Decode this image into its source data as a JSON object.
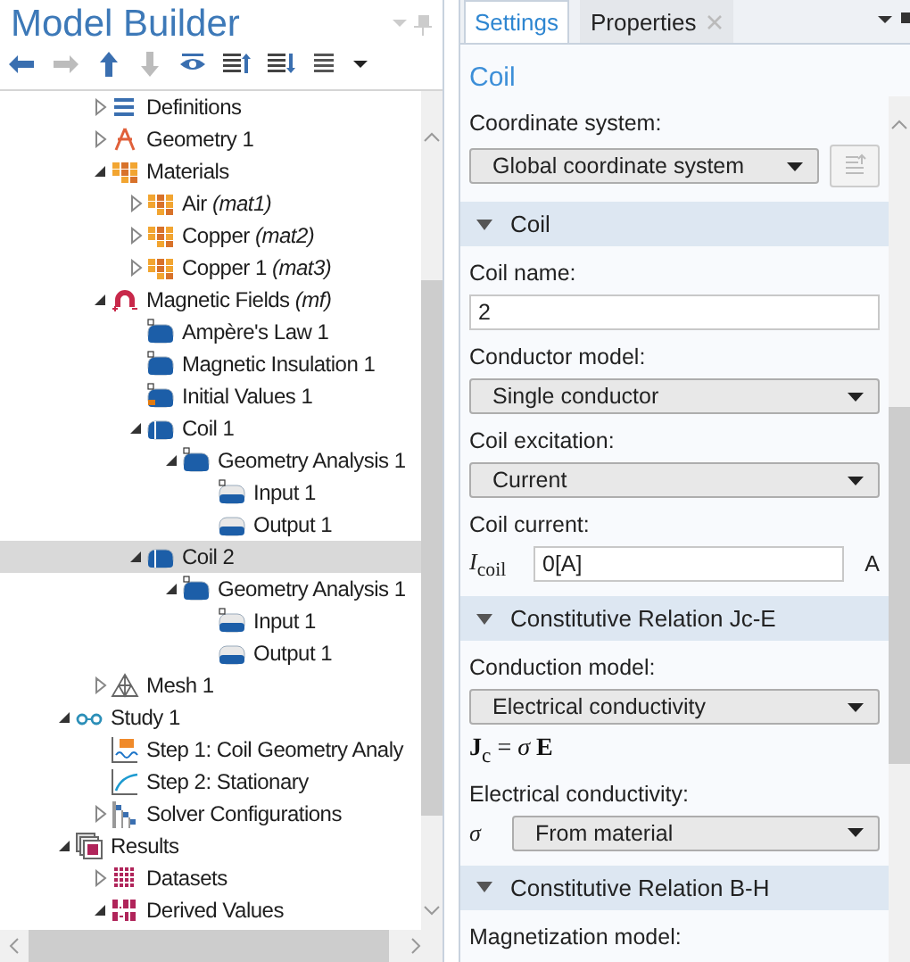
{
  "model_builder": {
    "title": "Model Builder",
    "toolbar": [
      {
        "kind": "back",
        "disabled": false
      },
      {
        "kind": "forward",
        "disabled": true
      },
      {
        "kind": "up",
        "disabled": false
      },
      {
        "kind": "down",
        "disabled": true
      },
      {
        "kind": "eye",
        "disabled": false
      },
      {
        "kind": "sort-up",
        "disabled": false
      },
      {
        "kind": "sort-down",
        "disabled": false
      },
      {
        "kind": "list",
        "disabled": false
      },
      {
        "kind": "caret",
        "disabled": false
      }
    ],
    "component_nodes": [
      {
        "label": "Definitions",
        "kind": "definitions",
        "expanded": false,
        "selected": false
      },
      {
        "label": "Geometry 1",
        "kind": "geometry",
        "expanded": false,
        "selected": false
      },
      {
        "label": "Materials",
        "kind": "material",
        "expanded": true,
        "selected": false,
        "children": [
          {
            "label": "Air *(mat1)*",
            "kind": "material",
            "expanded": false,
            "selected": false
          },
          {
            "label": "Copper *(mat2)*",
            "kind": "material",
            "expanded": false,
            "selected": false
          },
          {
            "label": "Copper 1 *(mat3)*",
            "kind": "material",
            "expanded": false,
            "selected": false
          }
        ]
      },
      {
        "label": "Magnetic Fields *(mf)*",
        "kind": "magnet",
        "expanded": true,
        "selected": false,
        "children": [
          {
            "label": "Ampère's Law 1",
            "kind": "domain",
            "selected": false
          },
          {
            "label": "Magnetic Insulation 1",
            "kind": "domain",
            "selected": false
          },
          {
            "label": "Initial Values 1",
            "kind": "initial",
            "selected": false
          },
          {
            "label": "Coil 1",
            "kind": "coil",
            "expanded": true,
            "selected": false,
            "children": [
              {
                "label": "Geometry Analysis 1",
                "kind": "domain",
                "expanded": true,
                "selected": false,
                "children": [
                  {
                    "label": "Input 1",
                    "kind": "input",
                    "selected": false
                  },
                  {
                    "label": "Output 1",
                    "kind": "output",
                    "selected": false
                  }
                ]
              }
            ]
          },
          {
            "label": "Coil 2",
            "kind": "coil",
            "expanded": true,
            "selected": true,
            "children": [
              {
                "label": "Geometry Analysis 1",
                "kind": "domain",
                "expanded": true,
                "selected": false,
                "children": [
                  {
                    "label": "Input 1",
                    "kind": "input",
                    "selected": false
                  },
                  {
                    "label": "Output 1",
                    "kind": "output",
                    "selected": false
                  }
                ]
              }
            ]
          }
        ]
      },
      {
        "label": "Mesh 1",
        "kind": "mesh",
        "expanded": false,
        "selected": false
      }
    ],
    "tree": [
      {
        "label": "Study 1",
        "kind": "study",
        "expanded": true,
        "selected": false,
        "children": [
          {
            "label": "Step 1: Coil Geometry Analy",
            "kind": "step-analysis",
            "selected": false
          },
          {
            "label": "Step 2: Stationary",
            "kind": "step-stationary",
            "selected": false
          },
          {
            "label": "Solver Configurations",
            "kind": "solver",
            "expanded": false,
            "selected": false
          }
        ]
      },
      {
        "label": "Results",
        "kind": "results",
        "expanded": true,
        "selected": false,
        "children": [
          {
            "label": "Datasets",
            "kind": "datasets",
            "expanded": false,
            "selected": false
          },
          {
            "label": "Derived Values",
            "kind": "derived",
            "expanded": true,
            "selected": false
          }
        ]
      }
    ]
  },
  "tabs": [
    {
      "label": "Settings",
      "selected": true
    },
    {
      "label": "Properties",
      "selected": false
    }
  ],
  "settings": {
    "title": "Coil",
    "groups": [
      {
        "items": [
          {
            "kind": "label",
            "text": "Coordinate system:"
          },
          {
            "kind": "select",
            "value": "Global coordinate system",
            "side_button": true
          }
        ]
      },
      {
        "header": "Coil",
        "expanded": true,
        "items": [
          {
            "kind": "label",
            "text": "Coil name:"
          },
          {
            "kind": "input",
            "value": "2"
          },
          {
            "kind": "label",
            "text": "Conductor model:"
          },
          {
            "kind": "select",
            "value": "Single conductor"
          },
          {
            "kind": "label",
            "text": "Coil excitation:"
          },
          {
            "kind": "select",
            "value": "Current"
          },
          {
            "kind": "label",
            "text": "Coil current:"
          },
          {
            "kind": "input",
            "prefix": "*I*$_{coil}$",
            "value": "0[A]",
            "unit": "A"
          }
        ]
      },
      {
        "header": "Constitutive Relation Jc-E",
        "expanded": true,
        "items": [
          {
            "kind": "label",
            "text": "Conduction model:"
          },
          {
            "kind": "select",
            "value": "Electrical conductivity"
          },
          {
            "kind": "equation",
            "text": "**J**$_{c}$ = *σ* **E**"
          },
          {
            "kind": "label",
            "text": "Electrical conductivity:"
          },
          {
            "kind": "select",
            "prefix": "*σ*",
            "value": "From material"
          }
        ]
      },
      {
        "header": "Constitutive Relation B-H",
        "expanded": true,
        "items": [
          {
            "kind": "label",
            "text": "Magnetization model:"
          }
        ]
      }
    ]
  }
}
